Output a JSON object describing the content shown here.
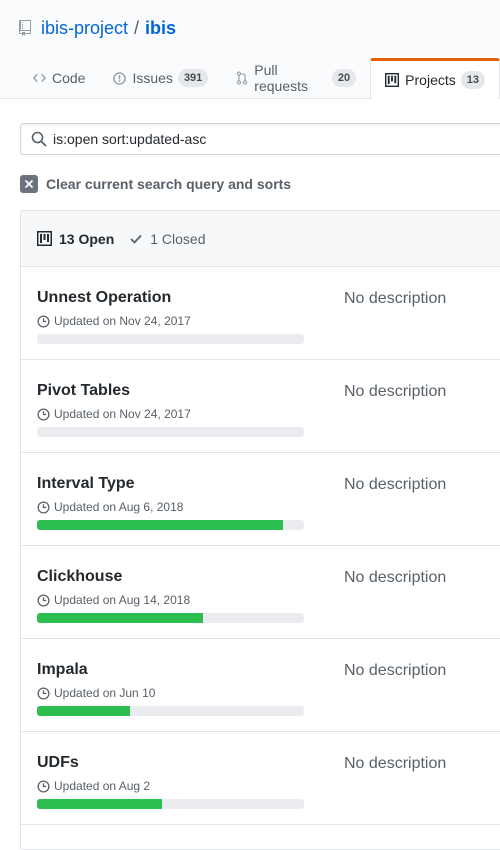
{
  "repo": {
    "owner": "ibis-project",
    "separator": "/",
    "name": "ibis"
  },
  "tabs": [
    {
      "label": "Code",
      "icon": "code-icon"
    },
    {
      "label": "Issues",
      "icon": "issue-icon",
      "count": "391"
    },
    {
      "label": "Pull requests",
      "icon": "pull-request-icon",
      "count": "20"
    },
    {
      "label": "Projects",
      "icon": "project-icon",
      "count": "13",
      "selected": true
    }
  ],
  "search": {
    "value": "is:open sort:updated-asc"
  },
  "clear_label": "Clear current search query and sorts",
  "states": {
    "open": "13 Open",
    "closed": "1 Closed"
  },
  "projects": [
    {
      "title": "Unnest Operation",
      "updated": "Updated on Nov 24, 2017",
      "progress": 0,
      "description": "No description"
    },
    {
      "title": "Pivot Tables",
      "updated": "Updated on Nov 24, 2017",
      "progress": 0,
      "description": "No description"
    },
    {
      "title": "Interval Type",
      "updated": "Updated on Aug 6, 2018",
      "progress": 0.92,
      "description": "No description"
    },
    {
      "title": "Clickhouse",
      "updated": "Updated on Aug 14, 2018",
      "progress": 0.62,
      "description": "No description"
    },
    {
      "title": "Impala",
      "updated": "Updated on Jun 10",
      "progress": 0.35,
      "description": "No description"
    },
    {
      "title": "UDFs",
      "updated": "Updated on Aug 2",
      "progress": 0.47,
      "description": "No description"
    }
  ],
  "colors": {
    "accent": "#0366d6",
    "progress": "#2cbe4e",
    "selected_tab_border": "#e36209"
  }
}
